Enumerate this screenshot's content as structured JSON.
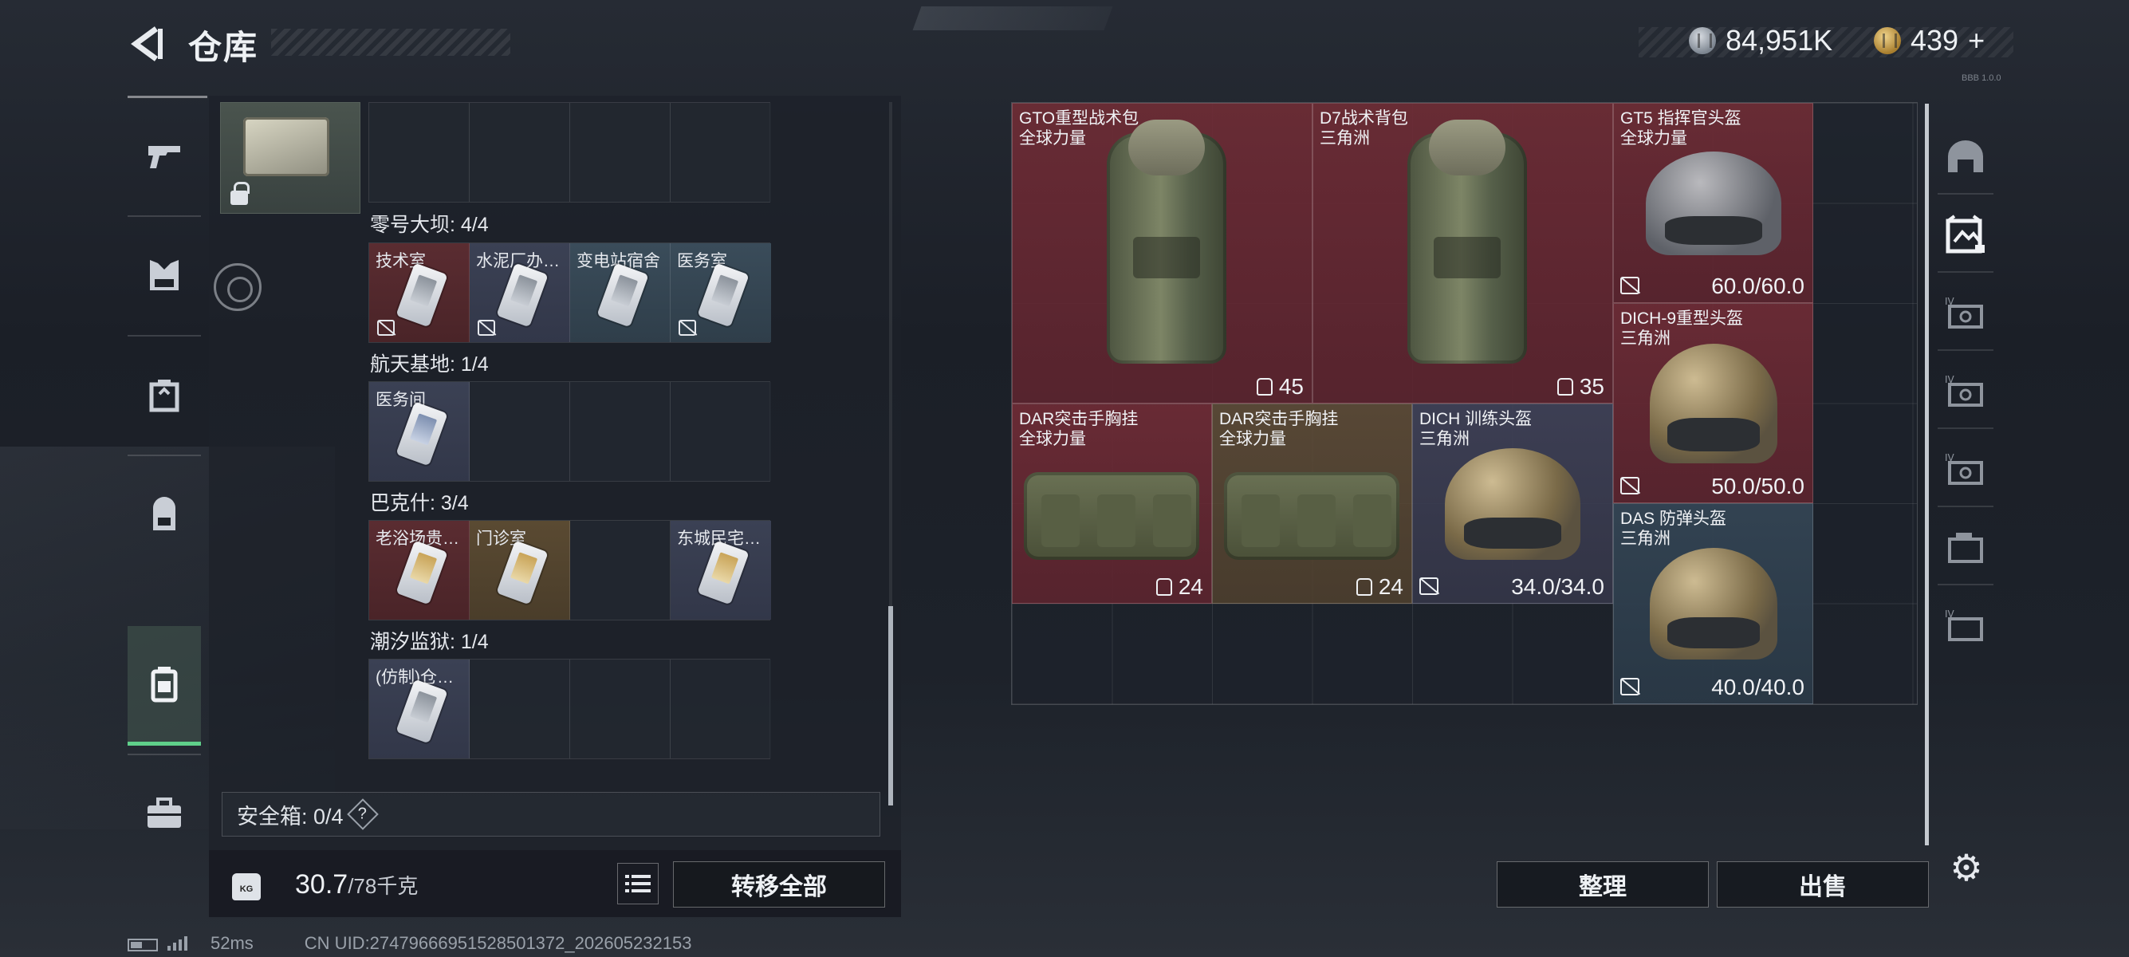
{
  "header": {
    "title": "仓库",
    "silver": "84,951K",
    "gold": "439",
    "gold_plus": "+"
  },
  "left_tabs": [
    {
      "name": "weapons-tab"
    },
    {
      "name": "armor-tab"
    },
    {
      "name": "chest-rig-tab"
    },
    {
      "name": "backpack-tab"
    },
    {
      "name": "keys-tab",
      "active": true
    },
    {
      "name": "medkit-tab"
    }
  ],
  "key_groups": [
    {
      "label": "零号大坝: 4/4",
      "slots": [
        {
          "label": "技术室",
          "color": "red"
        },
        {
          "label": "水泥厂办…",
          "color": "navy"
        },
        {
          "label": "变电站宿舍",
          "color": "blue"
        },
        {
          "label": "医务室",
          "color": "blue"
        }
      ]
    },
    {
      "label": "航天基地: 1/4",
      "slots": [
        {
          "label": "医务间",
          "color": "navy"
        },
        {
          "label": ""
        },
        {
          "label": ""
        },
        {
          "label": ""
        }
      ]
    },
    {
      "label": "巴克什: 3/4",
      "slots": [
        {
          "label": "老浴场贵…",
          "color": "red"
        },
        {
          "label": "门诊室",
          "color": "gold"
        },
        {
          "label": ""
        },
        {
          "label": "东城民宅…",
          "color": "navy"
        }
      ]
    },
    {
      "label": "潮汐监狱: 1/4",
      "slots": [
        {
          "label": "(仿制)仓…",
          "color": "navy"
        },
        {
          "label": ""
        },
        {
          "label": ""
        },
        {
          "label": ""
        }
      ]
    }
  ],
  "safe_box": {
    "label": "安全箱: 0/4",
    "help": "?"
  },
  "footer": {
    "weight_current": "30.7",
    "weight_max": "/78千克",
    "kg_badge": "KG",
    "transfer_all": "转移全部"
  },
  "status": {
    "ping": "52ms",
    "uid": "CN UID:27479666951528501372_202605232153"
  },
  "items": [
    {
      "name": "GTO重型战术包",
      "sub": "全球力量",
      "value": "45",
      "icon": "backpack",
      "color": "red"
    },
    {
      "name": "D7战术背包",
      "sub": "三角洲",
      "value": "35",
      "icon": "backpack",
      "color": "red"
    },
    {
      "name": "GT5 指挥官头盔",
      "sub": "全球力量",
      "value": "60.0/60.0",
      "color": "red"
    },
    {
      "name": "DICH-9重型头盔",
      "sub": "三角洲",
      "value": "50.0/50.0",
      "color": "red"
    },
    {
      "name": "DAR突击手胸挂",
      "sub": "全球力量",
      "value": "24",
      "icon": "rig",
      "color": "red"
    },
    {
      "name": "DAR突击手胸挂",
      "sub": "全球力量",
      "value": "24",
      "icon": "rig",
      "color": "gold"
    },
    {
      "name": "DICH 训练头盔",
      "sub": "三角洲",
      "value": "34.0/34.0",
      "color": "navy"
    },
    {
      "name": "DAS 防弹头盔",
      "sub": "三角洲",
      "value": "40.0/40.0",
      "color": "blue"
    }
  ],
  "right_tabs": [
    "helmet-tab",
    "armor-filter-tab",
    "tier4-tab-a",
    "tier4-tab-b",
    "tier4-tab-c",
    "case-tab",
    "tier4-tab-d"
  ],
  "actions": {
    "sort": "整理",
    "sell": "出售"
  },
  "version_label": "BBB 1.0.0"
}
